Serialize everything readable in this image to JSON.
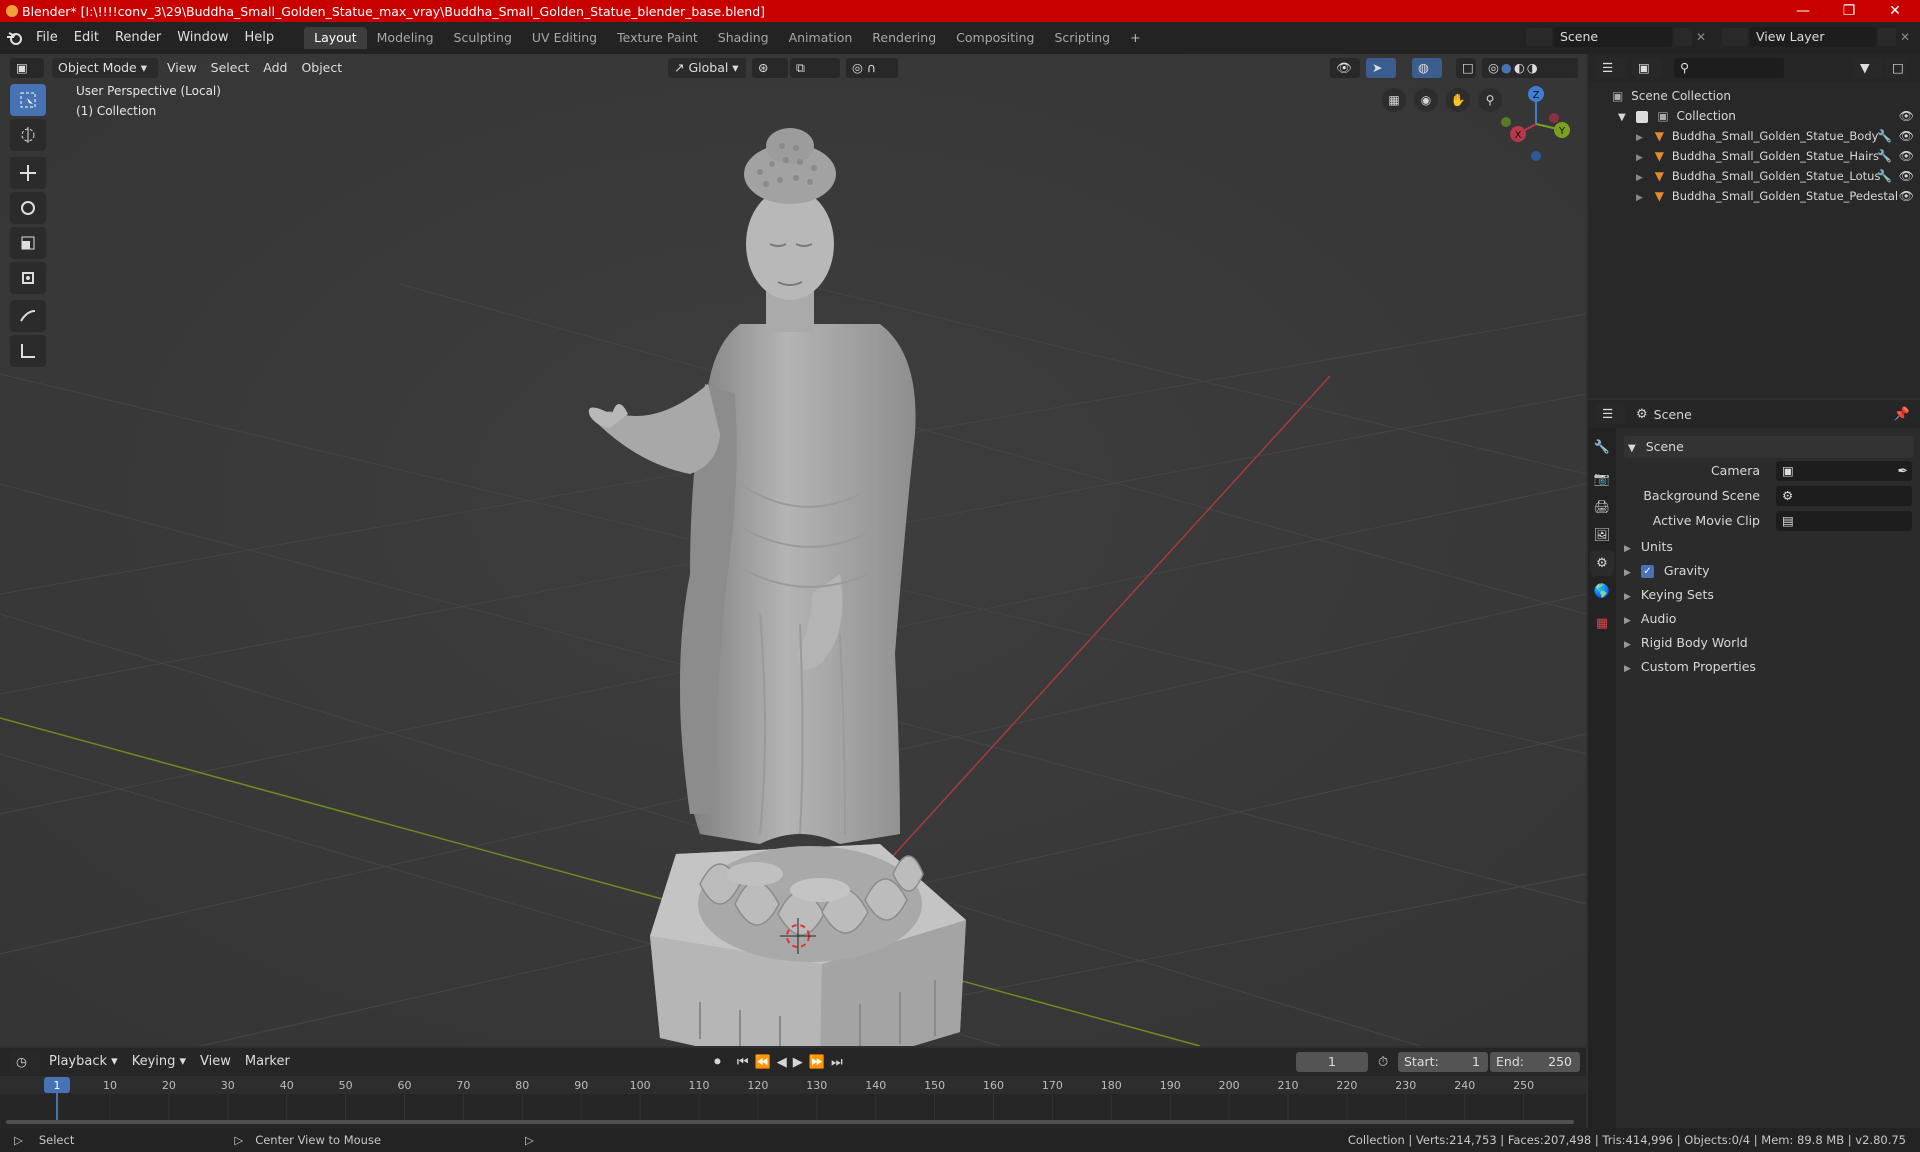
{
  "window": {
    "title": "Blender* [I:\\!!!!conv_3\\29\\Buddha_Small_Golden_Statue_max_vray\\Buddha_Small_Golden_Statue_blender_base.blend]",
    "minimize_icon": "minimize-icon",
    "maximize_icon": "maximize-icon",
    "close_icon": "close-icon"
  },
  "menu": {
    "items": [
      "File",
      "Edit",
      "Render",
      "Window",
      "Help"
    ],
    "workspaces": [
      "Layout",
      "Modeling",
      "Sculpting",
      "UV Editing",
      "Texture Paint",
      "Shading",
      "Animation",
      "Rendering",
      "Compositing",
      "Scripting"
    ],
    "active_workspace": "Layout",
    "add_tab": "+",
    "scene": "Scene",
    "view_layer": "View Layer"
  },
  "viewport": {
    "mode": "Object Mode",
    "menus": [
      "View",
      "Select",
      "Add",
      "Object"
    ],
    "transform_orientation": "Global",
    "overlay_text_line1": "User Perspective (Local)",
    "overlay_text_line2": "(1) Collection",
    "gizmo_x": "X",
    "gizmo_y": "Y",
    "gizmo_z": "Z"
  },
  "outliner": {
    "root": "Scene Collection",
    "collection": "Collection",
    "objects": [
      "Buddha_Small_Golden_Statue_Body",
      "Buddha_Small_Golden_Statue_Hairs",
      "Buddha_Small_Golden_Statue_Lotus",
      "Buddha_Small_Golden_Statue_Pedestal"
    ]
  },
  "properties": {
    "header": "Scene",
    "panel": "Scene",
    "camera_label": "Camera",
    "background_scene_label": "Background Scene",
    "active_movie_clip_label": "Active Movie Clip",
    "sections": [
      "Units",
      "Gravity",
      "Keying Sets",
      "Audio",
      "Rigid Body World",
      "Custom Properties"
    ],
    "gravity_checked": true
  },
  "timeline": {
    "menus": [
      "Playback",
      "Keying",
      "View",
      "Marker"
    ],
    "current_frame": "1",
    "start_label": "Start:",
    "start_value": "1",
    "end_label": "End:",
    "end_value": "250",
    "ruler": [
      "1",
      "10",
      "20",
      "30",
      "40",
      "50",
      "60",
      "70",
      "80",
      "90",
      "100",
      "110",
      "120",
      "130",
      "140",
      "150",
      "160",
      "170",
      "180",
      "190",
      "200",
      "210",
      "220",
      "230",
      "240",
      "250"
    ]
  },
  "status": {
    "select": "Select",
    "center": "Center View to Mouse",
    "stats": "Collection | Verts:214,753 | Faces:207,498 | Tris:414,996 | Objects:0/4 | Mem: 89.8 MB | v2.80.75"
  },
  "colors": {
    "title_bar": "#c90000",
    "accent": "#4772b3",
    "x_axis": "#b8384a",
    "y_axis": "#7aa020",
    "z_axis": "#3d7fd4",
    "mesh_icon": "#e58a2a"
  }
}
